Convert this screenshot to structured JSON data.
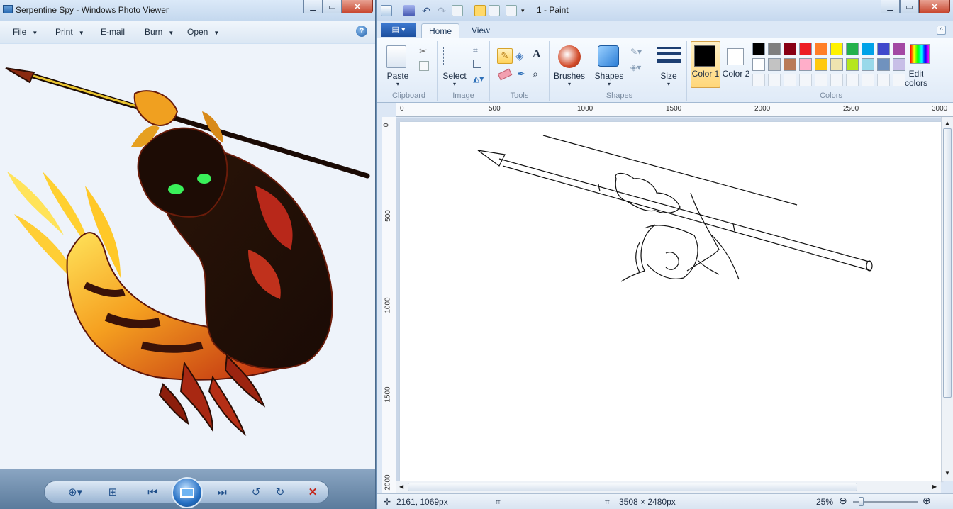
{
  "photo_viewer": {
    "title": "Serpentine Spy - Windows Photo Viewer",
    "menu": [
      {
        "label": "File",
        "has_arrow": true
      },
      {
        "label": "Print",
        "has_arrow": true
      },
      {
        "label": "E-mail",
        "has_arrow": false
      },
      {
        "label": "Burn",
        "has_arrow": true
      },
      {
        "label": "Open",
        "has_arrow": true
      }
    ],
    "help": "?",
    "controls": [
      "zoom-icon",
      "fit-window-icon",
      "previous-icon",
      "slideshow-icon",
      "next-icon",
      "rotate-counterclockwise-icon",
      "rotate-clockwise-icon",
      "delete-icon"
    ]
  },
  "paint": {
    "title": "1 - Paint",
    "tabs": {
      "home": "Home",
      "view": "View"
    },
    "ribbon": {
      "paste": "Paste",
      "select": "Select",
      "brushes": "Brushes",
      "shapes": "Shapes",
      "size": "Size",
      "color1": "Color 1",
      "color2": "Color 2",
      "edit_colors": "Edit colors",
      "groups": {
        "clipboard": "Clipboard",
        "image": "Image",
        "tools": "Tools",
        "shapes": "Shapes",
        "colors": "Colors"
      }
    },
    "palette_row1": [
      "#000000",
      "#7f7f7f",
      "#880015",
      "#ed1c24",
      "#ff7f27",
      "#fff200",
      "#22b14c",
      "#00a2e8",
      "#3f48cc",
      "#a349a4"
    ],
    "palette_row2": [
      "#ffffff",
      "#c3c3c3",
      "#b97a57",
      "#ffaec9",
      "#ffc90e",
      "#efe4b0",
      "#b5e61d",
      "#99d9ea",
      "#7092be",
      "#c8bfe7"
    ],
    "ruler_h": [
      "0",
      "500",
      "1000",
      "1500",
      "2000",
      "2500",
      "3000"
    ],
    "ruler_v": [
      "0",
      "500",
      "1000",
      "1500",
      "2000"
    ],
    "status": {
      "cursor": "2161, 1069px",
      "size": "3508 × 2480px",
      "zoom": "25%"
    }
  }
}
